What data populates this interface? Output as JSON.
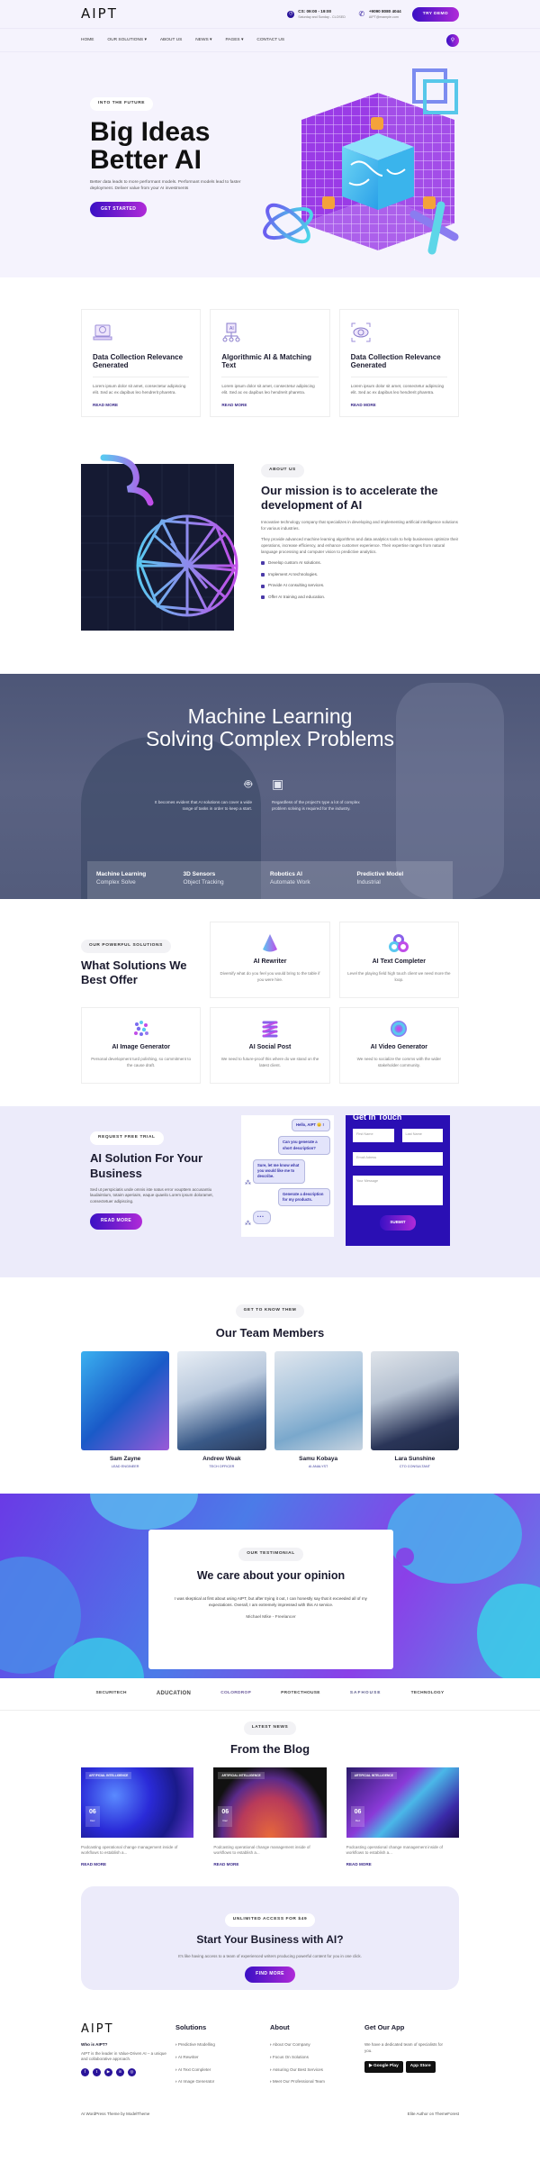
{
  "header": {
    "logo": "AIPT",
    "hours_title": "CS: 09:00 - 19:00",
    "hours_sub": "Saturday and Sunday - CLOSED",
    "phone_title": "+9090 8080 4044",
    "phone_sub": "AIPT@example.com",
    "demo_label": "TRY DEMO"
  },
  "nav": {
    "items": [
      "HOME",
      "OUR SOLUTIONS ▾",
      "ABOUT US",
      "NEWS ▾",
      "PAGES ▾",
      "CONTACT US"
    ]
  },
  "hero": {
    "badge": "INTO THE FUTURE",
    "title_line1": "Big Ideas",
    "title_line2": "Better AI",
    "text": "Better data leads to more performant models. Performant models lead to faster deployment. Deliver value from your AI investments",
    "button": "GET STARTED"
  },
  "features": [
    {
      "title": "Data Collection Relevance Generated",
      "text": "Lorem ipsum dolor sit amet, consectetur adipiscing elit. Sed ac ex dapibus leo hendrerit pharetra.",
      "link": "READ MORE"
    },
    {
      "title": "Algorithmic AI & Matching Text",
      "text": "Lorem ipsum dolor sit amet, consectetur adipiscing elit. Sed ac ex dapibus leo hendrerit pharetra.",
      "link": "READ MORE"
    },
    {
      "title": "Data Collection Relevance Generated",
      "text": "Lorem ipsum dolor sit amet, consectetur adipiscing elit. Sed ac ex dapibus leo hendrerit pharetra.",
      "link": "READ MORE"
    }
  ],
  "mission": {
    "badge": "ABOUT US",
    "title": "Our mission is to accelerate the development of AI",
    "p1": "Innovative technology company that specializes in developing and implementing artificial intelligence solutions for various industries.",
    "p2": "They provide advanced machine learning algorithms and data analytics tools to help businesses optimize their operations, increase efficiency, and enhance customer experience. Their expertise ranges from natural language processing and computer vision to predictive analytics.",
    "list": [
      "Develop custom AI solutions.",
      "Implement AI technologies.",
      "Provide AI consulting services.",
      "Offer AI training and education."
    ]
  },
  "ml": {
    "title_line1": "Machine Learning",
    "title_line2": "Solving Complex Problems",
    "col1": "It becomes evident that AI solutions can cover a wide range of tasks in order to keep a start.",
    "col2": "Regardless of the project's type a lot of complex problem solving is required for the industry.",
    "stats": [
      {
        "title": "Machine Learning",
        "sub": "Complex Solve"
      },
      {
        "title": "3D Sensors",
        "sub": "Object Tracking"
      },
      {
        "title": "Robotics AI",
        "sub": "Automate Work"
      },
      {
        "title": "Predictive Model",
        "sub": "Industrial"
      }
    ]
  },
  "solutions": {
    "badge": "OUR POWERFUL SOLUTIONS",
    "title": "What Solutions We Best Offer",
    "items": [
      {
        "title": "AI Rewriter",
        "text": "Diversify what do you feel you would bring to the table if you were hire."
      },
      {
        "title": "AI Text Completer",
        "text": "Level the playing field high touch client we need more the loop."
      },
      {
        "title": "AI Image Generator",
        "text": "Personal development turd polishing, so commitment to the cause draft."
      },
      {
        "title": "AI Social Post",
        "text": "We need to future-proof this where do we stand on the latest client."
      },
      {
        "title": "AI Video Generator",
        "text": "We need to socialize the comms with the wider stakeholder community."
      }
    ]
  },
  "trial": {
    "badge": "REQUEST FREE TRIAL",
    "title": "AI Solution For Your Business",
    "text": "Sed ut perspiciatis unde omnis iste natus error voupttem accusantiu laudaintium, totaim aperiaim, eaque quaeilo Lorem ipsum doloramet, consectetuer adipiscing.",
    "button": "READ MORE",
    "chat": [
      "Hello, AIPT 😊 !",
      "Can you generate a short description?",
      "Sure, let me know what you would like me to describe.",
      "Generate a description for my products.",
      "• • •"
    ],
    "form": {
      "title": "Get in Touch",
      "first": "First Name",
      "last": "Last Name",
      "email": "Email Adress",
      "message": "Your Message",
      "submit": "SUBMIT"
    }
  },
  "team": {
    "badge": "GET TO KNOW THEM",
    "title": "Our Team Members",
    "members": [
      {
        "name": "Sam Zayne",
        "role": "LEAD ENGINEER"
      },
      {
        "name": "Andrew Weak",
        "role": "TECH OFFICER"
      },
      {
        "name": "Samu Kobaya",
        "role": "AI ANALYST"
      },
      {
        "name": "Lara Sunshine",
        "role": "CTO CONSULTANT"
      }
    ]
  },
  "testimonial": {
    "badge": "OUR TESTIMONIAL",
    "title": "We care about your opinion",
    "quote": "I was skeptical at first about using AIPT, but after trying it out, I can honestly say that it exceeded all of my expectations. Overall, I am extremely impressed with this AI service.",
    "author": "Michael Mike - Freelancer"
  },
  "logos": [
    "SECURITECH",
    "ADUCATION",
    "COLORDROP",
    "PROTECTHOUSE",
    "SAFHOUSE",
    "TECHNOLOGY"
  ],
  "blog": {
    "badge": "LATEST NEWS",
    "title": "From the Blog",
    "posts": [
      {
        "category": "ARTIFICIAL INTELLIGENCE",
        "day": "06",
        "month": "Dec",
        "text": "Podcasting operational change management inside of workflows to establish a...",
        "link": "READ MORE"
      },
      {
        "category": "ARTIFICIAL INTELLIGENCE",
        "day": "06",
        "month": "Dec",
        "text": "Podcasting operational change management inside of workflows to establish a...",
        "link": "READ MORE"
      },
      {
        "category": "ARTIFICIAL INTELLIGENCE",
        "day": "06",
        "month": "Dec",
        "text": "Podcasting operational change management inside of workflows to establish a...",
        "link": "READ MORE"
      }
    ]
  },
  "cta": {
    "badge": "UNLIMITED ACCESS FOR $49",
    "title": "Start Your Business with AI?",
    "text": "It's like having access to a team of experienced writers producing powerful content for you in one click.",
    "button": "FIND MORE"
  },
  "footer": {
    "logo": "AIPT",
    "who": "Who is AIPT?",
    "desc": "AIPT is the leader in Value-Driven AI – a unique and collaborative approach.",
    "social": [
      "f",
      "t",
      "▶",
      "in",
      "◎"
    ],
    "solutions_title": "Solutions",
    "solutions": [
      "Predictive Modelling",
      "AI Rewriter",
      "AI Text Completer",
      "AI Image Generator"
    ],
    "about_title": "About",
    "about": [
      "About Our Company",
      "Focus On Solutions",
      "Assuring Our Best Services",
      "Meet Our Professional Team"
    ],
    "app_title": "Get Our App",
    "app_text": "We have a dedicated team of specialists for you.",
    "google": "▶ Google Play",
    "apple": " App Store",
    "copy_left": "AI WordPress Theme by ModelTheme",
    "copy_right": "Elite Author on ThemeForest"
  },
  "colors": {
    "accent_start": "#3a10c4",
    "accent_end": "#b02ad8",
    "dark_blue": "#2a0fb4",
    "hero_bg": "#f5f3fd"
  }
}
